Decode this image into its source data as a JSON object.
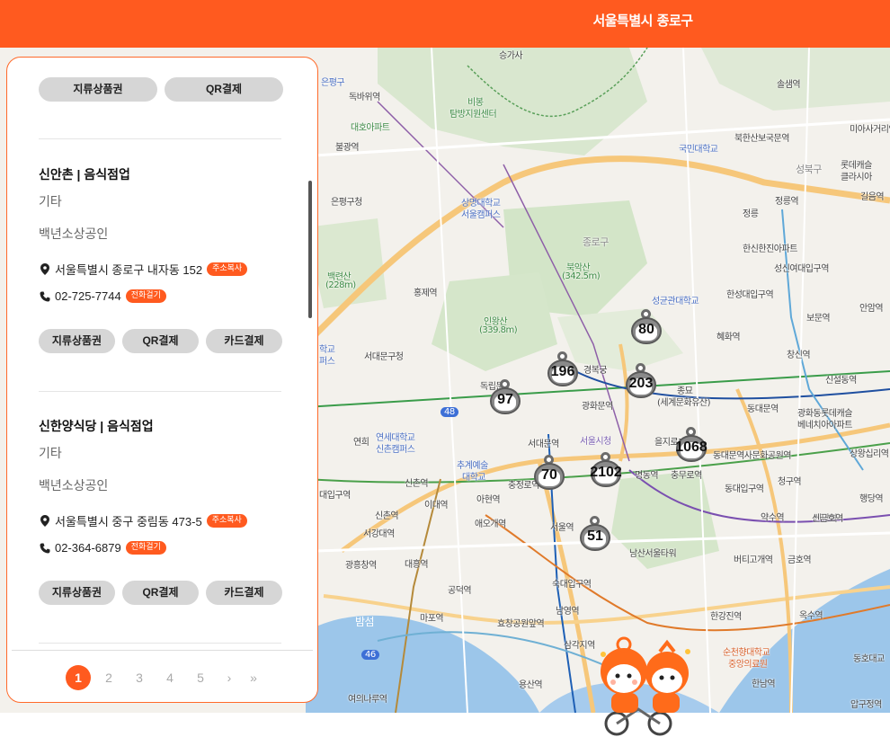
{
  "header": {
    "title": "서울특별시 종로구"
  },
  "panel": {
    "first_buttons": [
      "지류상품권",
      "QR결제"
    ],
    "stores": [
      {
        "name": "신안촌 | 음식점업",
        "category": "기타",
        "type": "백년소상공인",
        "address": "서울특별시 종로구 내자동 152",
        "address_tag": "주소복사",
        "phone": "02-725-7744",
        "phone_tag": "전화걸기",
        "buttons": [
          "지류상품권",
          "QR결제",
          "카드결제"
        ]
      },
      {
        "name": "신한양식당 | 음식점업",
        "category": "기타",
        "type": "백년소상공인",
        "address": "서울특별시 중구 중림동 473-5",
        "address_tag": "주소복사",
        "phone": "02-364-6879",
        "phone_tag": "전화걸기",
        "buttons": [
          "지류상품권",
          "QR결제",
          "카드결제"
        ]
      }
    ],
    "pagination": {
      "pages": [
        "1",
        "2",
        "3",
        "4",
        "5"
      ],
      "current": "1",
      "next": "›",
      "last": "»"
    }
  },
  "markers": [
    {
      "count": "80"
    },
    {
      "count": "196"
    },
    {
      "count": "203"
    },
    {
      "count": "97"
    },
    {
      "count": "1068"
    },
    {
      "count": "70"
    },
    {
      "count": "2102"
    },
    {
      "count": "51"
    }
  ],
  "map_labels": {
    "seungasa": "승가사",
    "eunpyeonggu": "은평구",
    "dokbawi": "독바위역",
    "daehoapt": "대호아파트",
    "bulgwang": "불광역",
    "bibong": "비봉",
    "tamsang": "탐방지원센터",
    "eunpyeong_office": "은평구청",
    "baekryeonsan": "백련산",
    "baekryeonsan_h": "(228m)",
    "sangmyung": "상명대학교",
    "sangmyung2": "서울캠퍼스",
    "jongnogu": "종로구",
    "bugaksan": "북악산",
    "bugaksan_h": "(342.5m)",
    "hongje": "홍제역",
    "inwangsan": "인왕산",
    "inwangsan_h": "(339.8m)",
    "seodaemun_office": "서대문구청",
    "dongnimmun": "독립문",
    "sogyo": "숭례문",
    "yonsei": "연세대학교",
    "yonsei2": "신촌캠퍼스",
    "chugye": "추계예술",
    "chugye2": "대학교",
    "sinchon": "신촌역",
    "idae": "이대역",
    "ahyeon": "아현역",
    "aeogae": "애오개역",
    "seogangdae": "서강대역",
    "daeheung": "대흥역",
    "gwangheungchang": "광흥창역",
    "gongdeok": "공덕역",
    "mapo": "마포역",
    "bamseom": "밤섬",
    "yeouinaru": "여의나루역",
    "hyochang": "효창공원앞역",
    "namyeong": "남영역",
    "samgakji": "삼각지역",
    "yongsan": "용산역",
    "sookdae": "숙대입구역",
    "seoul_station": "서울역",
    "namsan_tower": "남산서울타워",
    "myeongdong": "명동역",
    "chungmuro": "충무로역",
    "chungjeongno": "충정로역",
    "seodaemun": "서대문역",
    "cityhall": "서울시청",
    "gwanghwamun": "광화문역",
    "gyeongbokgung": "경복궁",
    "jongmyo": "종묘",
    "jongmyo2": "(세계문화유산)",
    "euljiro3": "을지로3가역",
    "ddp": "동대문역사문화공원역",
    "dongdaemun": "동대문역",
    "dongdaemun_ipgu": "동대입구역",
    "yaksu": "약수역",
    "sindang": "신당역",
    "cheonggu": "청구역",
    "sangwangsimni": "상왕십리역",
    "haengdang": "행당역",
    "geumho": "금호역",
    "beotigogae": "버티고개역",
    "hannam": "한남역",
    "oksu": "옥수역",
    "hangangjin": "한강진역",
    "soonchunhyang": "순천향대학교",
    "soonchunhyang2": "중앙의료원",
    "apgujeong": "압구정역",
    "dongho": "동호대교",
    "singeumho": "신금호역",
    "seongbukgu": "성북구",
    "kookmin": "국민대학교",
    "bukhansan_ipgu": "북한산보국문역",
    "solsaem": "솔샘역",
    "miasageori": "미아사거리역",
    "lotte": "롯데캐슬",
    "lotte2": "클라시아",
    "jeongneung": "정릉역",
    "jeongneung2": "정릉",
    "gireum": "길음역",
    "hanshin": "한신한진아파트",
    "sungshin": "성신여대입구역",
    "hansung": "한성대입구역",
    "bomun": "보문역",
    "anam": "안암역",
    "hyehwa": "혜화역",
    "sungkyunkwan": "성균관대학교",
    "changsin": "창신역",
    "sinseoldong": "신설동역",
    "gwanghwadong": "광화동롯데캐슬",
    "gwanghwadong2": "베네치아아파트",
    "yeonhui": "연희",
    "daeipgu": "대입구역",
    "hakgyo": "학교",
    "pus": "퍼스",
    "road48": "48",
    "road46": "46"
  },
  "colors": {
    "accent": "#ff5a1f",
    "pill": "#d6d6d6",
    "marker": "#8a8a8a"
  }
}
